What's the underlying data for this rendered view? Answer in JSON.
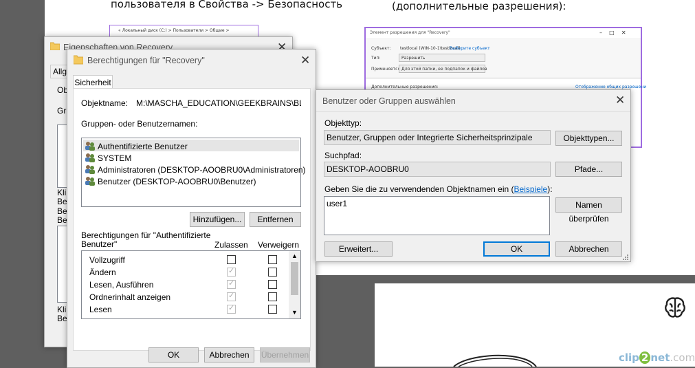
{
  "slide": {
    "caption_left": "пользователя в Свойства -> Безопасность",
    "caption_right": "(дополнительные разрешения):"
  },
  "mini_explorer": {
    "path": "« Локальный диск (C:) > Пользователи > Общие >"
  },
  "mini_perm": {
    "title": "Элемент разрешения для \"Recovery\"",
    "subject_label": "Субъект:",
    "subject_value": "testlocal (WIN-10-1\\testlocal)",
    "subject_link": "Выберите субъект",
    "type_label": "Тип:",
    "type_value": "Разрешить",
    "applies_label": "Применяется к:",
    "applies_value": "Для этой папки, ее подпапок и файлов",
    "adv_label": "Дополнительные разрешения:",
    "adv_link": "Отображение общих разрешени"
  },
  "props": {
    "title": "Eigenschaften von Recovery",
    "tab_partial": "Allge",
    "obj_partial": "Obj",
    "gru_partial": "Gru",
    "kli1": "Kli",
    "be1": "Be",
    "be2": "Be",
    "be3": "Be",
    "kli2": "Kli",
    "be4": "Be"
  },
  "perm": {
    "title": "Berechtigungen für \"Recovery\"",
    "tab_security": "Sicherheit",
    "objname_label": "Objektname:",
    "objname_value": "M:\\MASCHA_EDUCATION\\GEEKBRAINS\\BLOK",
    "groups_label": "Gruppen- oder Benutzernamen:",
    "users": [
      "Authentifizierte Benutzer",
      "SYSTEM",
      "Administratoren (DESKTOP-AOOBRU0\\Administratoren)",
      "Benutzer (DESKTOP-AOOBRU0\\Benutzer)"
    ],
    "add_button": "Hinzufügen...",
    "remove_button": "Entfernen",
    "perms_for_line1": "Berechtigungen für \"Authentifizierte",
    "perms_for_line2": "Benutzer\"",
    "allow_header": "Zulassen",
    "deny_header": "Verweigern",
    "permissions": [
      "Vollzugriff",
      "Ändern",
      "Lesen, Ausführen",
      "Ordnerinhalt anzeigen",
      "Lesen"
    ],
    "ok_button": "OK",
    "cancel_button": "Abbrechen",
    "apply_button": "Übernehmen"
  },
  "select": {
    "title": "Benutzer oder Gruppen auswählen",
    "objtype_label": "Objekttyp:",
    "objtype_value": "Benutzer, Gruppen oder Integrierte Sicherheitsprinzipale",
    "objtype_button": "Objekttypen...",
    "path_label": "Suchpfad:",
    "path_value": "DESKTOP-AOOBRU0",
    "path_button": "Pfade...",
    "names_label_pre": "Geben Sie die zu verwendenden Objektnamen ein (",
    "names_link": "Beispiele",
    "names_label_post": "):",
    "names_value": "user1",
    "check_button": "Namen überprüfen",
    "advanced_button": "Erweitert...",
    "ok_button": "OK",
    "cancel_button": "Abbrechen"
  },
  "watermark": {
    "brand_part1": "clip",
    "brand_part2": "2",
    "brand_part3": "net",
    "brand_part4": ".com"
  },
  "colors": {
    "link": "#0066cc",
    "accent_border": "#9e6be0",
    "select_highlight": "#e5e5e5"
  }
}
